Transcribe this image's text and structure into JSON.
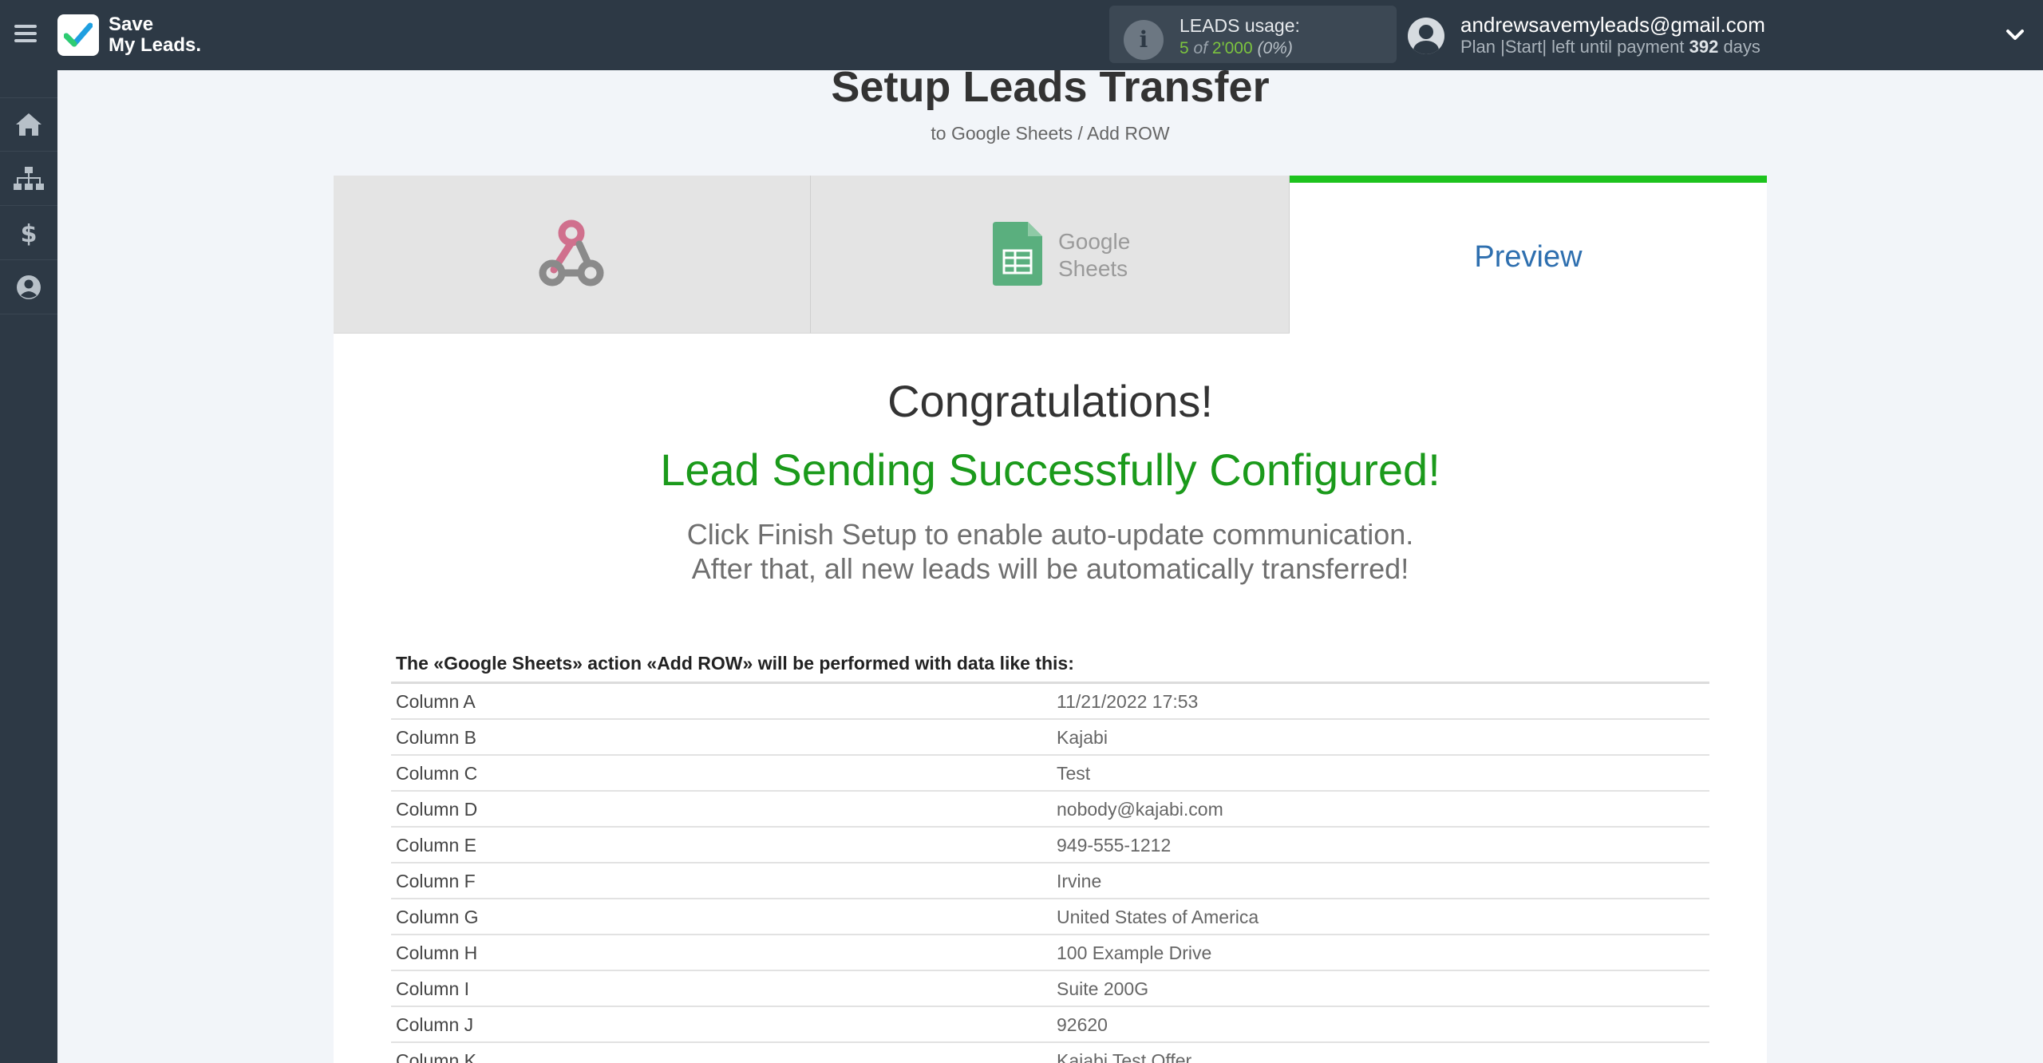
{
  "app": {
    "logo_line1": "Save",
    "logo_line2": "My Leads."
  },
  "usage": {
    "title": "LEADS usage:",
    "used": "5",
    "of": "of",
    "total": "2'000",
    "percent": "(0%)"
  },
  "user": {
    "email": "andrewsavemyleads@gmail.com",
    "plan_text": "Plan |Start| left until payment",
    "days": "392",
    "days_suffix": "days"
  },
  "sidebar": {
    "items": [
      {
        "icon": "home-icon"
      },
      {
        "icon": "sitemap-icon"
      },
      {
        "icon": "dollar-icon"
      },
      {
        "icon": "user-circle-icon"
      }
    ]
  },
  "page": {
    "title": "Setup Leads Transfer",
    "subtitle": "to Google Sheets / Add ROW"
  },
  "tabs": [
    {
      "icon": "webhook-icon"
    },
    {
      "icon": "google-sheets-icon",
      "text_line1": "Google",
      "text_line2": "Sheets"
    },
    {
      "label": "Preview"
    }
  ],
  "messages": {
    "congrats": "Congratulations!",
    "success": "Lead Sending Successfully Configured!",
    "hint_line1": "Click Finish Setup to enable auto-update communication.",
    "hint_line2": "After that, all new leads will be automatically transferred!"
  },
  "table": {
    "caption": "The «Google Sheets» action «Add ROW» will be performed with data like this:",
    "rows": [
      {
        "key": "Column A",
        "value": "11/21/2022 17:53"
      },
      {
        "key": "Column B",
        "value": "Kajabi"
      },
      {
        "key": "Column C",
        "value": "Test"
      },
      {
        "key": "Column D",
        "value": "nobody@kajabi.com"
      },
      {
        "key": "Column E",
        "value": "949-555-1212"
      },
      {
        "key": "Column F",
        "value": "Irvine"
      },
      {
        "key": "Column G",
        "value": "United States of America"
      },
      {
        "key": "Column H",
        "value": "100 Example Drive"
      },
      {
        "key": "Column I",
        "value": "Suite 200G"
      },
      {
        "key": "Column J",
        "value": "92620"
      },
      {
        "key": "Column K",
        "value": "Kajabi Test Offer"
      }
    ]
  },
  "colors": {
    "topbar": "#2d3945",
    "accent_green": "#1ec31e",
    "success_text": "#1b9a1b",
    "link_blue": "#2e6faf"
  }
}
